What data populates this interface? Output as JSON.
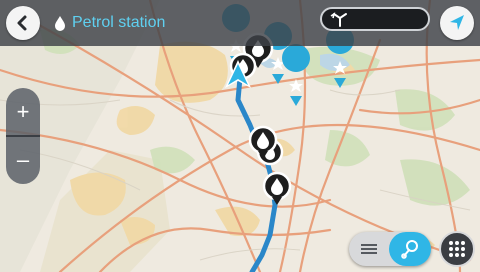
{
  "header": {
    "title": "Petrol station",
    "back_icon": "back-arrow-icon",
    "category_icon": "fuel-drop-icon"
  },
  "search": {
    "icon": "route-fork-icon"
  },
  "navigation": {
    "icon": "navigation-arrow-icon"
  },
  "zoom": {
    "in_label": "+",
    "out_label": "–"
  },
  "view_toggle": {
    "list_icon": "list-view-icon",
    "map_icon": "map-pin-icon"
  },
  "main_menu": {
    "icon": "grid-menu-icon"
  },
  "colors": {
    "accent": "#2fb6e6",
    "title_text": "#5fd0f0",
    "route": "#2a87c9",
    "fuel_pin": "#1e1e1e",
    "favorite_pin": "#2aa9d9",
    "background": "#efeae0"
  }
}
